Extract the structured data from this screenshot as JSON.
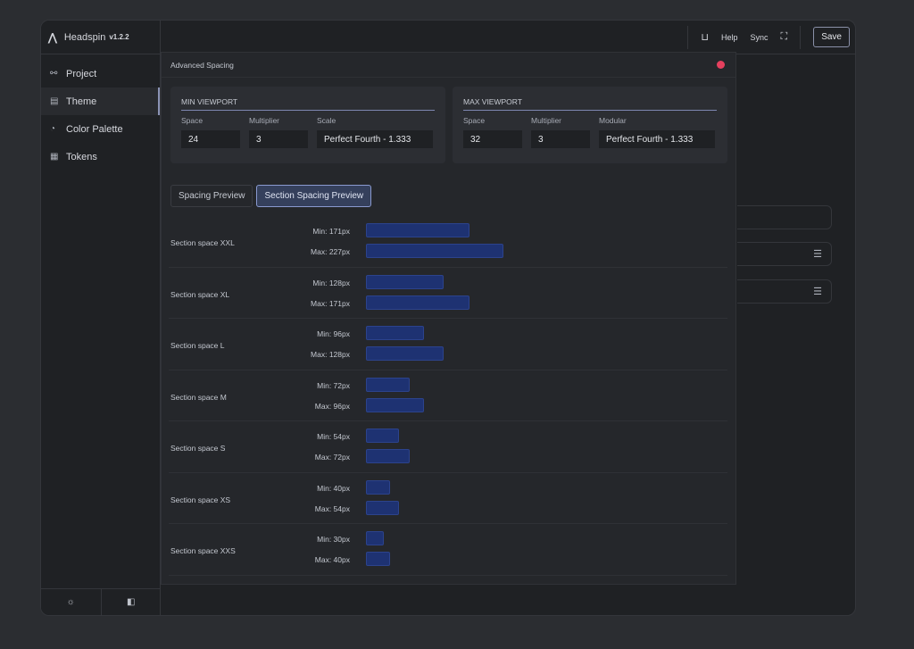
{
  "app": {
    "name": "Headspin",
    "version": "v1.2.2"
  },
  "sidebar": {
    "items": [
      {
        "label": "Project",
        "icon": "project-nodes-icon"
      },
      {
        "label": "Theme",
        "icon": "theme-icon",
        "active": true
      },
      {
        "label": "Color Palette",
        "icon": "palette-icon"
      },
      {
        "label": "Tokens",
        "icon": "tokens-icon"
      }
    ]
  },
  "topbar": {
    "help": "Help",
    "sync": "Sync",
    "save": "Save"
  },
  "modal": {
    "title": "Advanced Spacing",
    "min_viewport": {
      "title": "MIN VIEWPORT",
      "space_label": "Space",
      "space": "24",
      "multiplier_label": "Multiplier",
      "multiplier": "3",
      "scale_label": "Scale",
      "scale": "Perfect Fourth - 1.333"
    },
    "max_viewport": {
      "title": "MAX VIEWPORT",
      "space_label": "Space",
      "space": "32",
      "multiplier_label": "Multiplier",
      "multiplier": "3",
      "scale_label": "Modular",
      "scale": "Perfect Fourth - 1.333"
    },
    "tabs": [
      {
        "label": "Spacing Preview"
      },
      {
        "label": "Section Spacing Preview",
        "active": true
      }
    ],
    "sections": [
      {
        "name": "Section space XXL",
        "min": 171,
        "max": 227
      },
      {
        "name": "Section space XL",
        "min": 128,
        "max": 171
      },
      {
        "name": "Section space L",
        "min": 96,
        "max": 128
      },
      {
        "name": "Section space M",
        "min": 72,
        "max": 96
      },
      {
        "name": "Section space S",
        "min": 54,
        "max": 72
      },
      {
        "name": "Section space XS",
        "min": 40,
        "max": 54
      },
      {
        "name": "Section space XXS",
        "min": 30,
        "max": 40
      }
    ]
  },
  "colors": {
    "bar": "#1e3272",
    "close_dot": "#e5405e",
    "accent": "#7d86b0"
  }
}
